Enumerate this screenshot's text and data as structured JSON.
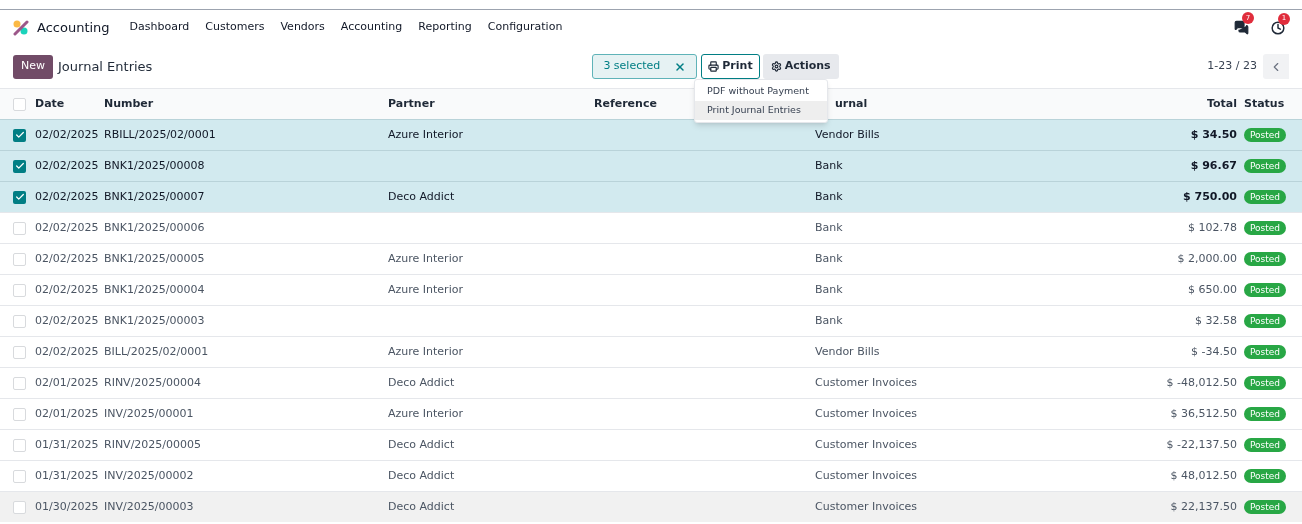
{
  "navbar": {
    "app_name": "Accounting",
    "menu": [
      "Dashboard",
      "Customers",
      "Vendors",
      "Accounting",
      "Reporting",
      "Configuration"
    ],
    "messages_badge": "7",
    "activity_badge": "1"
  },
  "control_panel": {
    "new_button": "New",
    "breadcrumb": "Journal Entries",
    "selection": "3 selected",
    "print_button": "Print",
    "actions_button": "Actions",
    "pager": "1-23 / 23"
  },
  "print_menu": [
    {
      "label": "PDF without Payment",
      "highlighted": false
    },
    {
      "label": "Print Journal Entries",
      "highlighted": true
    }
  ],
  "table": {
    "all_selected": false,
    "columns": [
      "Date",
      "Number",
      "Partner",
      "Reference",
      "urnal",
      "Total",
      "Status"
    ],
    "rows": [
      {
        "selected": true,
        "hovered": false,
        "date": "02/02/2025",
        "number": "RBILL/2025/02/0001",
        "partner": "Azure Interior",
        "journal": "Vendor Bills",
        "total": "$ 34.50",
        "status": "Posted"
      },
      {
        "selected": true,
        "hovered": false,
        "date": "02/02/2025",
        "number": "BNK1/2025/00008",
        "journal": "Bank",
        "total": "$ 96.67",
        "status": "Posted"
      },
      {
        "selected": true,
        "hovered": false,
        "date": "02/02/2025",
        "number": "BNK1/2025/00007",
        "partner": "Deco Addict",
        "journal": "Bank",
        "total": "$ 750.00",
        "status": "Posted"
      },
      {
        "selected": false,
        "hovered": false,
        "date": "02/02/2025",
        "number": "BNK1/2025/00006",
        "journal": "Bank",
        "total": "$ 102.78",
        "status": "Posted"
      },
      {
        "selected": false,
        "hovered": false,
        "date": "02/02/2025",
        "number": "BNK1/2025/00005",
        "partner": "Azure Interior",
        "journal": "Bank",
        "total": "$ 2,000.00",
        "status": "Posted"
      },
      {
        "selected": false,
        "hovered": false,
        "date": "02/02/2025",
        "number": "BNK1/2025/00004",
        "partner": "Azure Interior",
        "journal": "Bank",
        "total": "$ 650.00",
        "status": "Posted"
      },
      {
        "selected": false,
        "hovered": false,
        "date": "02/02/2025",
        "number": "BNK1/2025/00003",
        "journal": "Bank",
        "total": "$ 32.58",
        "status": "Posted"
      },
      {
        "selected": false,
        "hovered": false,
        "date": "02/02/2025",
        "number": "BILL/2025/02/0001",
        "partner": "Azure Interior",
        "journal": "Vendor Bills",
        "total": "$ -34.50",
        "status": "Posted"
      },
      {
        "selected": false,
        "hovered": false,
        "date": "02/01/2025",
        "number": "RINV/2025/00004",
        "partner": "Deco Addict",
        "journal": "Customer Invoices",
        "total": "$ -48,012.50",
        "status": "Posted"
      },
      {
        "selected": false,
        "hovered": false,
        "date": "02/01/2025",
        "number": "INV/2025/00001",
        "partner": "Azure Interior",
        "journal": "Customer Invoices",
        "total": "$ 36,512.50",
        "status": "Posted"
      },
      {
        "selected": false,
        "hovered": false,
        "date": "01/31/2025",
        "number": "RINV/2025/00005",
        "partner": "Deco Addict",
        "journal": "Customer Invoices",
        "total": "$ -22,137.50",
        "status": "Posted"
      },
      {
        "selected": false,
        "hovered": false,
        "date": "01/31/2025",
        "number": "INV/2025/00002",
        "partner": "Deco Addict",
        "journal": "Customer Invoices",
        "total": "$ 48,012.50",
        "status": "Posted"
      },
      {
        "selected": false,
        "hovered": true,
        "date": "01/30/2025",
        "number": "INV/2025/00003",
        "partner": "Deco Addict",
        "journal": "Customer Invoices",
        "total": "$ 22,137.50",
        "status": "Posted"
      }
    ]
  }
}
